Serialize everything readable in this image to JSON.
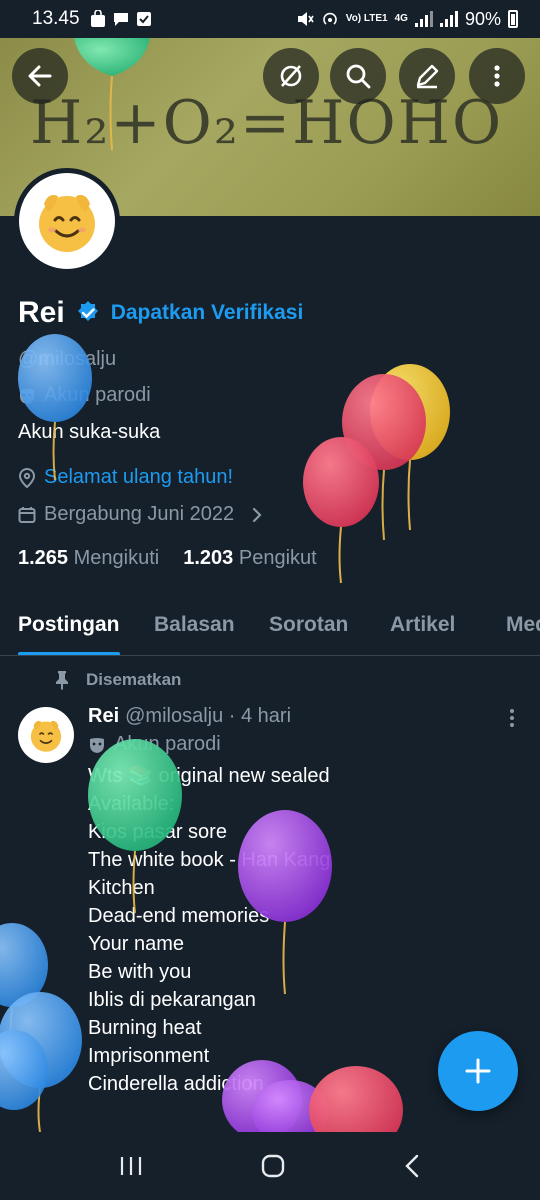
{
  "status_bar": {
    "time": "13.45",
    "network": "Vo) LTE1",
    "network_type": "4G",
    "battery": "90%"
  },
  "banner": {
    "formula": "H₂+O₂=HOHO"
  },
  "profile": {
    "name": "Rei",
    "verify_link": "Dapatkan Verifikasi",
    "handle": "@milosalju",
    "parody_label": "Akun parodi",
    "bio": "Akun suka-suka",
    "location": "Selamat ulang tahun!",
    "joined": "Bergabung Juni 2022",
    "following_count": "1.265",
    "following_label": "Mengikuti",
    "followers_count": "1.203",
    "followers_label": "Pengikut"
  },
  "tabs": [
    {
      "label": "Postingan",
      "active": true
    },
    {
      "label": "Balasan",
      "active": false
    },
    {
      "label": "Sorotan",
      "active": false
    },
    {
      "label": "Artikel",
      "active": false
    },
    {
      "label": "Media",
      "active": false
    }
  ],
  "pinned_post": {
    "pinned_label": "Disematkan",
    "author": "Rei",
    "meta": "@milosalju · 4 hari",
    "parody_label": "Akun parodi",
    "body": "Wts 📚 original new sealed\nAvailable:\nKios pasar sore\nThe white book - Han Kang\nKitchen\nDead-end memories\nYour name\nBe with you\nIblis di pekarangan\nBurning heat\nImprisonment\nCinderella addiction"
  },
  "colors": {
    "background": "#15202b",
    "accent": "#1d9bf0",
    "muted": "#8b98a5"
  },
  "icons": [
    "back-arrow-icon",
    "grok-icon",
    "search-icon",
    "edit-icon",
    "more-vertical-icon",
    "verified-badge-icon",
    "parody-mask-icon",
    "location-pin-icon",
    "calendar-icon",
    "chevron-right-icon",
    "pin-icon",
    "plus-icon",
    "nav-recents-icon",
    "nav-home-icon",
    "nav-back-icon"
  ]
}
